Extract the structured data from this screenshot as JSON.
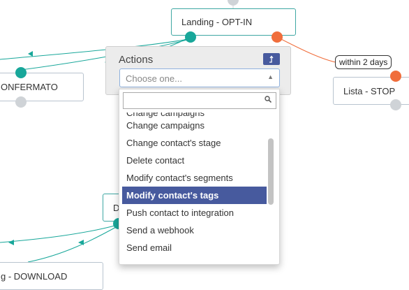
{
  "nodes": {
    "landing": "Landing - OPT-IN",
    "confermato": "ONFERMATO",
    "stop": "Lista - STOP",
    "download": "g - DOWNLOAD",
    "partial": "D"
  },
  "edge_label": "within 2 days",
  "actions_panel": {
    "title": "Actions",
    "collapse_icon": "collapse-arrow-icon",
    "select_placeholder": "Choose one...",
    "search_value": "",
    "options": [
      {
        "label": "Change campaigns"
      },
      {
        "label": "Change contact's stage"
      },
      {
        "label": "Delete contact"
      },
      {
        "label": "Modify contact's segments"
      },
      {
        "label": "Modify contact's tags"
      },
      {
        "label": "Push contact to integration"
      },
      {
        "label": "Send a webhook"
      },
      {
        "label": "Send email"
      }
    ],
    "highlighted": "Modify contact's tags"
  },
  "colors": {
    "accent": "#475a9e",
    "node_border": "#3ea7a3",
    "connector_teal": "#18a79a",
    "connector_orange": "#f06e3c",
    "connector_gray": "#cfd3d7"
  }
}
